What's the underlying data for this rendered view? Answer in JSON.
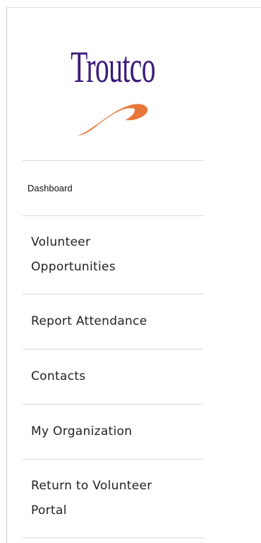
{
  "logo": {
    "text": "Troutco",
    "colors": {
      "text": "#3b1a7a",
      "fish": "#e8773a"
    },
    "icon": "trout-fish-swoosh"
  },
  "nav": {
    "items": [
      {
        "label": "Dashboard"
      },
      {
        "label": "Volunteer Opportunities"
      },
      {
        "label": "Report Attendance"
      },
      {
        "label": "Contacts"
      },
      {
        "label": "My Organization"
      },
      {
        "label": "Return to Volunteer Portal"
      }
    ]
  }
}
